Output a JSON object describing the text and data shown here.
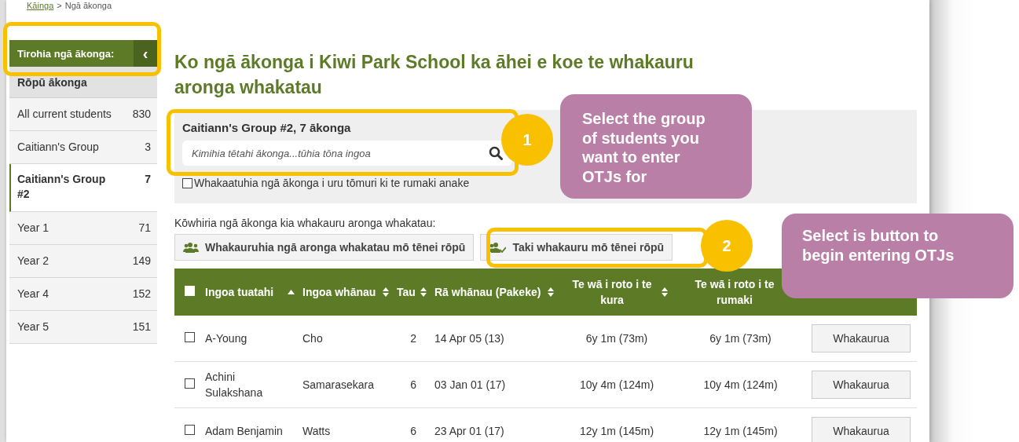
{
  "breadcrumb": {
    "link": "Kāinga",
    "separator": ">",
    "current": "Ngā ākonga"
  },
  "sidebar": {
    "title": "Tirohia ngā ākonga:",
    "toggle": "‹",
    "section": "Rōpū ākonga",
    "items": [
      {
        "label": "All current students",
        "count": "830",
        "selected": false
      },
      {
        "label": "Caitiann's Group",
        "count": "3",
        "selected": false
      },
      {
        "label": "Caitiann's Group #2",
        "count": "7",
        "selected": true
      },
      {
        "label": "Year 1",
        "count": "71",
        "selected": false
      },
      {
        "label": "Year 2",
        "count": "149",
        "selected": false
      },
      {
        "label": "Year 4",
        "count": "152",
        "selected": false
      },
      {
        "label": "Year 5",
        "count": "151",
        "selected": false
      }
    ]
  },
  "title": "Ko ngā ākonga i Kiwi Park School ka āhei e koe te whakauru aronga whakatau",
  "filter": {
    "group_title": "Caitiann's Group #2, 7 ākonga",
    "search": {
      "placeholder": "Kimihia tētahi ākonga...tūhia tōna ingoa"
    },
    "checkbox": {
      "label": "Whakaatuhia ngā ākonga i uru tōmuri ki te rumaki anake",
      "checked": false
    }
  },
  "select_label": "Kōwhiria ngā ākonga kia whakauru aronga whakatau:",
  "actions": [
    {
      "label": "Whakauruhia ngā aronga whakatau mō tēnei rōpū",
      "kind": "group"
    },
    {
      "label": "Taki whakauru mō tēnei rōpū",
      "kind": "check"
    }
  ],
  "table": {
    "select_all": {
      "checked": false
    },
    "columns": [
      {
        "label": "Ingoa tuatahi",
        "sorted": true
      },
      {
        "label": "Ingoa whānau",
        "sorted": false
      },
      {
        "label": "Tau",
        "sorted": false
      },
      {
        "label": "Rā whānau (Pakeke)",
        "sorted": false
      },
      {
        "label": "Te wā i roto i te kura",
        "sorted": false
      },
      {
        "label": "Te wā i roto i te rumaki"
      }
    ],
    "rows": [
      {
        "checked": false,
        "cells": [
          "A-Young",
          "Cho",
          "2",
          "14 Apr 05 (13)",
          "6y 1m (73m)",
          "6y 1m (73m)"
        ],
        "action": "Whakaurua"
      },
      {
        "checked": false,
        "cells": [
          "Achini Sulakshana",
          "Samarasekara",
          "6",
          "03 Jan 01 (17)",
          "10y 4m (124m)",
          "10y 4m (124m)"
        ],
        "action": "Whakaurua"
      },
      {
        "checked": false,
        "cells": [
          "Adam Benjamin",
          "Watts",
          "6",
          "23 Apr 01 (17)",
          "12y 1m (145m)",
          "12y 1m (145m)"
        ],
        "action": "Whakaurua"
      }
    ]
  },
  "annotations": [
    {
      "number": "1",
      "text": "Select the group of students you want to enter OTJs for"
    },
    {
      "number": "2",
      "text": "Select is button to begin entering OTJs"
    }
  ]
}
